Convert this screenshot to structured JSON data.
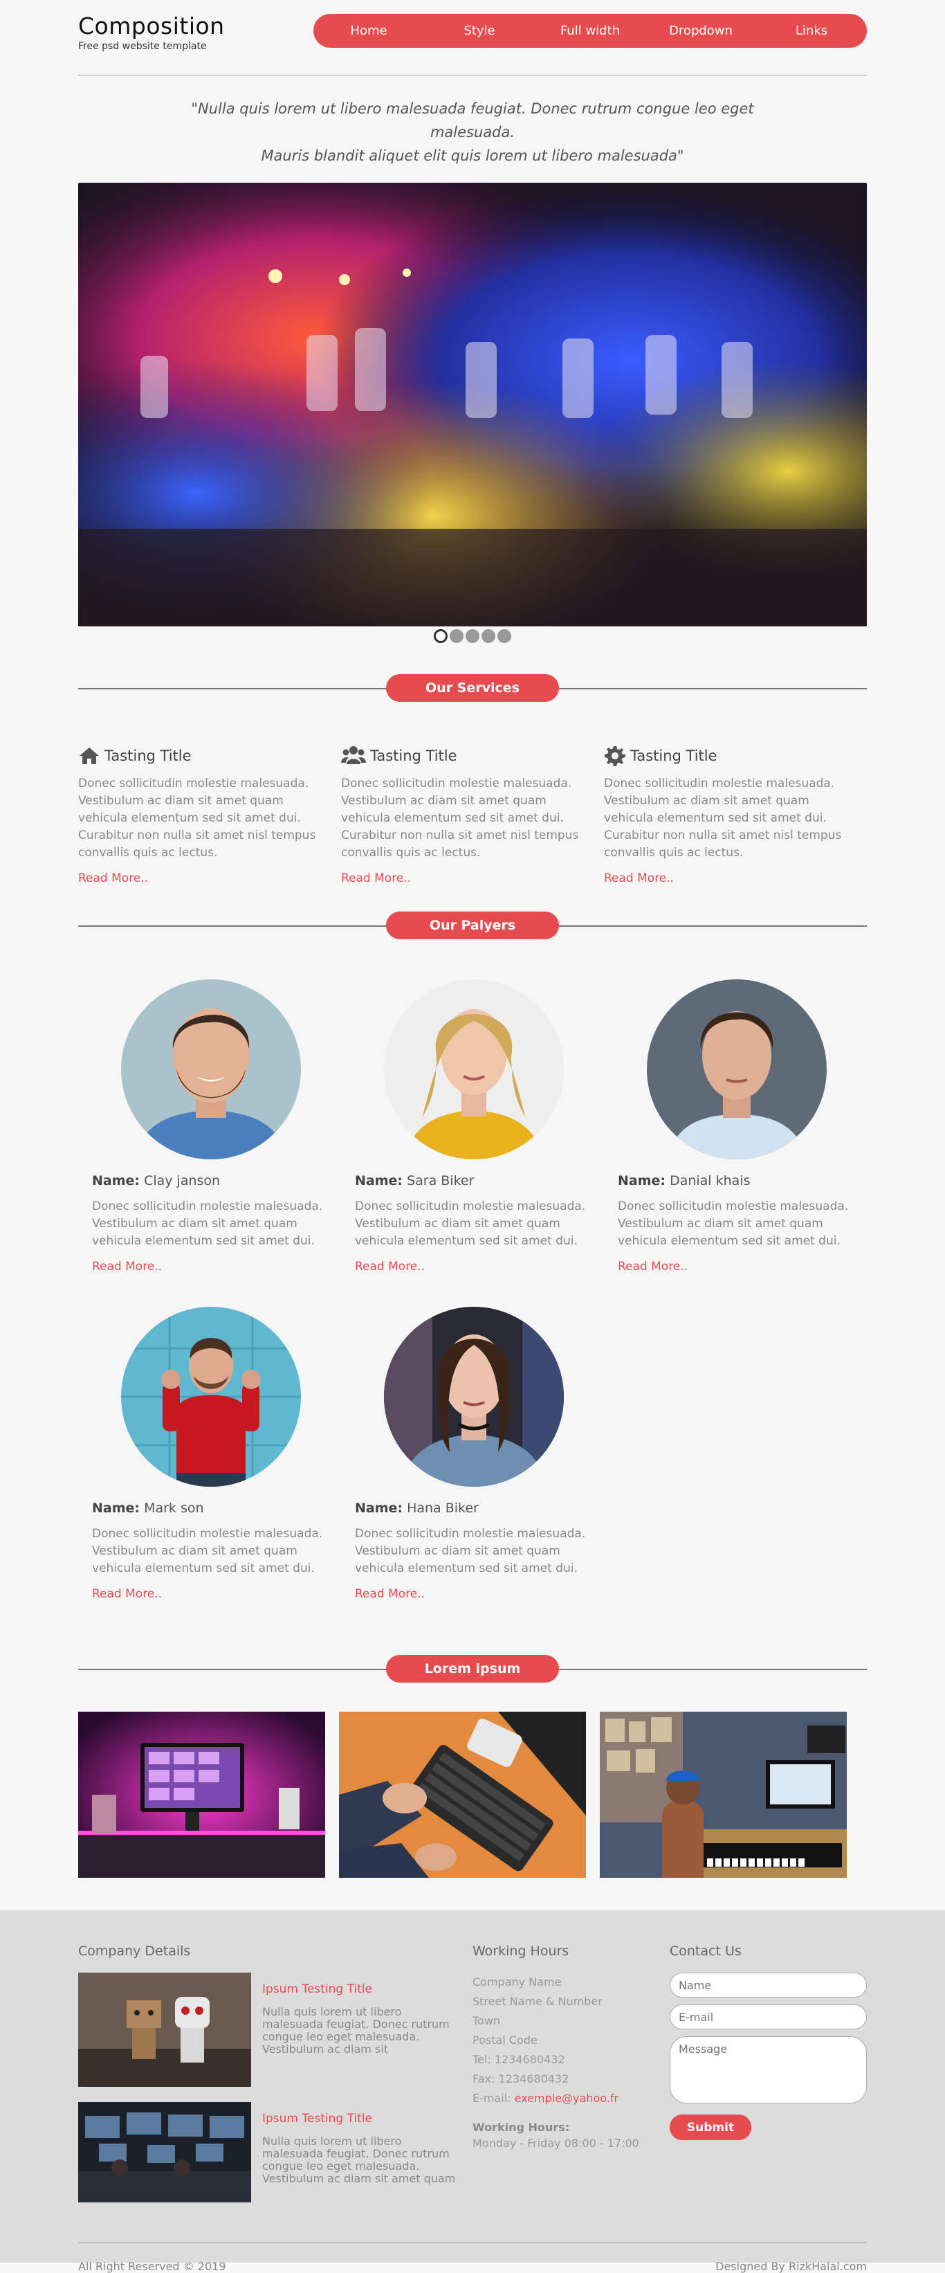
{
  "header": {
    "brand_title": "Composition",
    "brand_sub": "Free psd website template",
    "nav": [
      "Home",
      "Style",
      "Full width",
      "Dropdown",
      "Links"
    ],
    "accent_color": "#e54b4f"
  },
  "quote": {
    "line1": "\"Nulla quis lorem ut libero malesuada feugiat. Donec rutrum congue leo eget malesuada.",
    "line2": "Mauris blandit aliquet elit quis lorem ut libero malesuada\""
  },
  "hero": {
    "slide_count": 5,
    "active_slide": 1,
    "icon": "colored-smoke-crowd-photo"
  },
  "services": {
    "title": "Our Services",
    "items": [
      {
        "icon": "home-icon",
        "title": "Tasting Title",
        "text": "Donec sollicitudin molestie malesuada. Vestibulum ac diam sit amet quam vehicula elementum sed sit amet dui. Curabitur non nulla sit amet nisl tempus convallis quis ac lectus.",
        "link": "Read More.."
      },
      {
        "icon": "users-icon",
        "title": "Tasting Title",
        "text": "Donec sollicitudin molestie malesuada. Vestibulum ac diam sit amet quam vehicula elementum sed sit amet dui. Curabitur non nulla sit amet nisl tempus convallis quis ac lectus.",
        "link": "Read More.."
      },
      {
        "icon": "gear-icon",
        "title": "Tasting Title",
        "text": "Donec sollicitudin molestie malesuada. Vestibulum ac diam sit amet quam vehicula elementum sed sit amet dui. Curabitur non nulla sit amet nisl tempus convallis quis ac lectus.",
        "link": "Read More.."
      }
    ]
  },
  "players": {
    "title": "Our Palyers",
    "name_label": "Name:",
    "items": [
      {
        "name": "Clay janson",
        "text": "Donec sollicitudin molestie malesuada. Vestibulum ac diam sit amet quam vehicula elementum sed sit amet dui.",
        "link": "Read More.."
      },
      {
        "name": "Sara Biker",
        "text": "Donec sollicitudin molestie malesuada. Vestibulum ac diam sit amet quam vehicula elementum sed sit amet dui.",
        "link": "Read More.."
      },
      {
        "name": "Danial khais",
        "text": "Donec sollicitudin molestie malesuada. Vestibulum ac diam sit amet quam vehicula elementum sed sit amet dui.",
        "link": "Read More.."
      },
      {
        "name": "Mark son",
        "text": "Donec sollicitudin molestie malesuada. Vestibulum ac diam sit amet quam vehicula elementum sed sit amet dui.",
        "link": "Read More.."
      },
      {
        "name": "Hana Biker",
        "text": "Donec sollicitudin molestie malesuada. Vestibulum ac diam sit amet quam vehicula elementum sed sit amet dui.",
        "link": "Read More.."
      }
    ]
  },
  "gallery": {
    "title": "Lorem ipsum"
  },
  "footer": {
    "company": {
      "heading": "Company Details",
      "items": [
        {
          "title": "Ipsum Testing Title",
          "text": "Nulla quis lorem ut libero malesuada feugiat. Donec rutrum congue leo eget malesuada. Vestibulum ac diam sit"
        },
        {
          "title": "Ipsum Testing Title",
          "text": "Nulla quis lorem ut libero malesuada feugiat. Donec rutrum congue leo eget malesuada. Vestibulum ac diam sit amet quam"
        }
      ]
    },
    "working": {
      "heading": "Working Hours",
      "company_name": "Company Name",
      "street": "Street Name & Number",
      "town": "Town",
      "postal": "Postal Code",
      "tel": "Tel: 1234680432",
      "fax": "Fax: 1234680432",
      "email_label": "E-mail: ",
      "email": "exemple@yahoo.fr",
      "hours_heading": "Working Hours:",
      "hours": "Monday - Friday 08:00 - 17:00"
    },
    "contact": {
      "heading": "Contact Us",
      "name_placeholder": "Name",
      "email_placeholder": "E-mail",
      "message_placeholder": "Message",
      "submit": "Submit"
    },
    "copyright": "All Right Reserved © 2019",
    "designed_by": "Designed By RizkHalal.com"
  }
}
